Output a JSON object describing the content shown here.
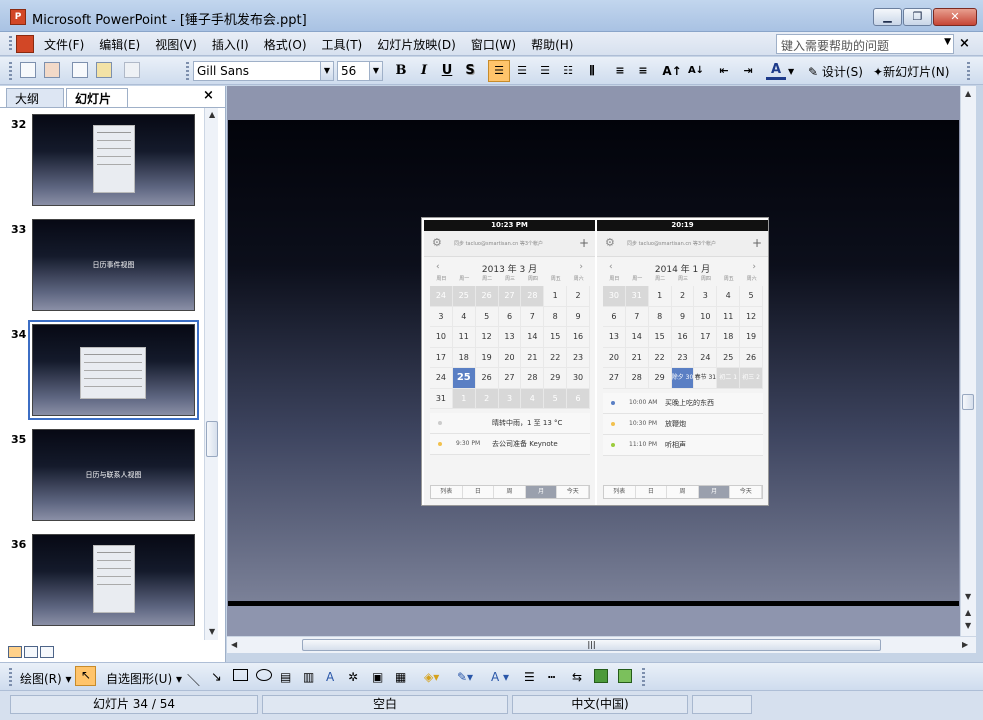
{
  "window": {
    "title": "Microsoft PowerPoint - [锤子手机发布会.ppt]",
    "app_icon_text": "P",
    "minimize": "▁",
    "restore": "❐",
    "close": "✕"
  },
  "menu": {
    "items": [
      "文件(F)",
      "编辑(E)",
      "视图(V)",
      "插入(I)",
      "格式(O)",
      "工具(T)",
      "幻灯片放映(D)",
      "窗口(W)",
      "帮助(H)"
    ],
    "help_placeholder": "键入需要帮助的问题",
    "close": "×"
  },
  "toolbar": {
    "font": "Gill Sans",
    "size": "56",
    "bold": "B",
    "italic": "I",
    "underline": "U",
    "shadow": "S",
    "design": "设计(S)",
    "new_slide": "新幻灯片(N)",
    "font_color": "A"
  },
  "panel": {
    "tab_outline": "大纲",
    "tab_slides": "幻灯片",
    "close": "×"
  },
  "slides": [
    {
      "num": "32",
      "kind": "image",
      "text": ""
    },
    {
      "num": "33",
      "kind": "text",
      "text": "日历事件视图"
    },
    {
      "num": "34",
      "kind": "calendar",
      "text": "",
      "selected": true
    },
    {
      "num": "35",
      "kind": "text",
      "text": "日历与联系人视图"
    },
    {
      "num": "36",
      "kind": "image",
      "text": ""
    }
  ],
  "calendar_left": {
    "status_time": "10:23 PM",
    "sync": "同步 tacluo@smartisan.cn 等3个帐户",
    "month": "2013 年 3 月",
    "weekdays": [
      "周日",
      "周一",
      "周二",
      "周三",
      "周四",
      "周五",
      "周六"
    ],
    "cells": [
      {
        "d": "24",
        "c": "dim"
      },
      {
        "d": "25",
        "c": "dim"
      },
      {
        "d": "26",
        "c": "dim"
      },
      {
        "d": "27",
        "c": "dim"
      },
      {
        "d": "28",
        "c": "dim"
      },
      {
        "d": "1",
        "c": ""
      },
      {
        "d": "2",
        "c": ""
      },
      {
        "d": "3",
        "c": ""
      },
      {
        "d": "4",
        "c": ""
      },
      {
        "d": "5",
        "c": ""
      },
      {
        "d": "6",
        "c": ""
      },
      {
        "d": "7",
        "c": ""
      },
      {
        "d": "8",
        "c": ""
      },
      {
        "d": "9",
        "c": ""
      },
      {
        "d": "10",
        "c": ""
      },
      {
        "d": "11",
        "c": ""
      },
      {
        "d": "12",
        "c": ""
      },
      {
        "d": "13",
        "c": ""
      },
      {
        "d": "14",
        "c": ""
      },
      {
        "d": "15",
        "c": ""
      },
      {
        "d": "16",
        "c": ""
      },
      {
        "d": "17",
        "c": ""
      },
      {
        "d": "18",
        "c": ""
      },
      {
        "d": "19",
        "c": ""
      },
      {
        "d": "20",
        "c": ""
      },
      {
        "d": "21",
        "c": ""
      },
      {
        "d": "22",
        "c": ""
      },
      {
        "d": "23",
        "c": ""
      },
      {
        "d": "24",
        "c": ""
      },
      {
        "d": "25",
        "c": "today"
      },
      {
        "d": "26",
        "c": ""
      },
      {
        "d": "27",
        "c": ""
      },
      {
        "d": "28",
        "c": ""
      },
      {
        "d": "29",
        "c": ""
      },
      {
        "d": "30",
        "c": ""
      },
      {
        "d": "31",
        "c": ""
      },
      {
        "d": "1",
        "c": "dim"
      },
      {
        "d": "2",
        "c": "dim"
      },
      {
        "d": "3",
        "c": "dim"
      },
      {
        "d": "4",
        "c": "dim"
      },
      {
        "d": "5",
        "c": "dim"
      },
      {
        "d": "6",
        "c": "dim"
      }
    ],
    "events": [
      {
        "time": "",
        "text": "晴转中雨，1 至 13 °C",
        "color": "#cccccc"
      },
      {
        "time": "9:30 PM",
        "text": "去公司准备 Keynote",
        "color": "#f2c14e"
      }
    ],
    "tabs": [
      "列表",
      "日",
      "周",
      "月",
      "今天"
    ],
    "active_tab": "月"
  },
  "calendar_right": {
    "status_time": "20:19",
    "sync": "同步 tacluo@smartisan.cn 等3个帐户",
    "month": "2014 年 1 月",
    "weekdays": [
      "周日",
      "周一",
      "周二",
      "周三",
      "周四",
      "周五",
      "周六"
    ],
    "cells": [
      {
        "d": "30",
        "c": "dim"
      },
      {
        "d": "31",
        "c": "dim"
      },
      {
        "d": "1",
        "c": ""
      },
      {
        "d": "2",
        "c": ""
      },
      {
        "d": "3",
        "c": ""
      },
      {
        "d": "4",
        "c": ""
      },
      {
        "d": "5",
        "c": ""
      },
      {
        "d": "6",
        "c": ""
      },
      {
        "d": "7",
        "c": ""
      },
      {
        "d": "8",
        "c": ""
      },
      {
        "d": "9",
        "c": ""
      },
      {
        "d": "10",
        "c": ""
      },
      {
        "d": "11",
        "c": ""
      },
      {
        "d": "12",
        "c": ""
      },
      {
        "d": "13",
        "c": ""
      },
      {
        "d": "14",
        "c": ""
      },
      {
        "d": "15",
        "c": ""
      },
      {
        "d": "16",
        "c": ""
      },
      {
        "d": "17",
        "c": ""
      },
      {
        "d": "18",
        "c": ""
      },
      {
        "d": "19",
        "c": ""
      },
      {
        "d": "20",
        "c": ""
      },
      {
        "d": "21",
        "c": ""
      },
      {
        "d": "22",
        "c": ""
      },
      {
        "d": "23",
        "c": ""
      },
      {
        "d": "24",
        "c": ""
      },
      {
        "d": "25",
        "c": ""
      },
      {
        "d": "26",
        "c": ""
      },
      {
        "d": "27",
        "c": ""
      },
      {
        "d": "28",
        "c": ""
      },
      {
        "d": "29",
        "c": ""
      },
      {
        "d": "除夕 30",
        "c": "sel"
      },
      {
        "d": "春节 31",
        "c": "small"
      },
      {
        "d": "初二 1",
        "c": "dim small"
      },
      {
        "d": "初三 2",
        "c": "dim small"
      }
    ],
    "events": [
      {
        "time": "10:00 AM",
        "text": "买晚上吃的东西",
        "color": "#5a7fc4"
      },
      {
        "time": "10:30 PM",
        "text": "放鞭炮",
        "color": "#f2c14e"
      },
      {
        "time": "11:10 PM",
        "text": "听相声",
        "color": "#9ccc3c"
      }
    ],
    "tabs": [
      "列表",
      "日",
      "周",
      "月",
      "今天"
    ],
    "active_tab": "月"
  },
  "drawbar": {
    "draw": "绘图(R)",
    "autoshapes": "自选图形(U)"
  },
  "status": {
    "slide": "幻灯片 34 / 54",
    "design": "空白",
    "language": "中文(中国)"
  }
}
